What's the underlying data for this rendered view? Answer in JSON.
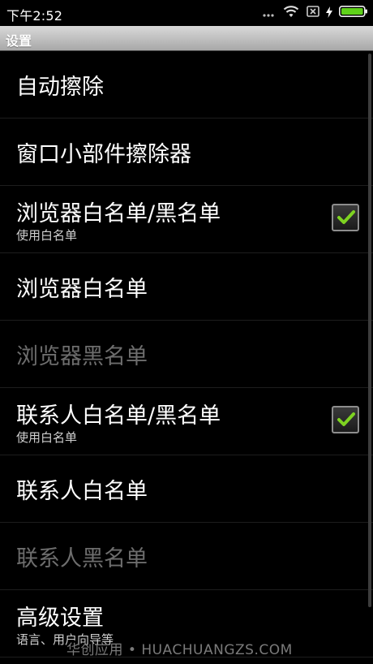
{
  "status_bar": {
    "time": "下午2:52",
    "icons": [
      "signal-dots-icon",
      "wifi-icon",
      "no-sim-icon",
      "charging-icon",
      "battery-icon"
    ],
    "battery_color": "#5fd11a"
  },
  "action_bar": {
    "title": "设置"
  },
  "settings": [
    {
      "title": "自动擦除",
      "summary": "",
      "enabled": true,
      "checkbox": false
    },
    {
      "title": "窗口小部件擦除器",
      "summary": "",
      "enabled": true,
      "checkbox": false
    },
    {
      "title": "浏览器白名单/黑名单",
      "summary": "使用白名单",
      "enabled": true,
      "checkbox": true,
      "checked": true
    },
    {
      "title": "浏览器白名单",
      "summary": "",
      "enabled": true,
      "checkbox": false
    },
    {
      "title": "浏览器黑名单",
      "summary": "",
      "enabled": false,
      "checkbox": false
    },
    {
      "title": "联系人白名单/黑名单",
      "summary": "使用白名单",
      "enabled": true,
      "checkbox": true,
      "checked": true
    },
    {
      "title": "联系人白名单",
      "summary": "",
      "enabled": true,
      "checkbox": false
    },
    {
      "title": "联系人黑名单",
      "summary": "",
      "enabled": false,
      "checkbox": false
    },
    {
      "title": "高级设置",
      "summary": "语言、用户向导等",
      "enabled": true,
      "checkbox": false
    }
  ],
  "watermark": "华创应用 • HUACHUANGZS.COM",
  "colors": {
    "check_mark": "#7ed321",
    "disabled_text": "#6d6d6d"
  }
}
